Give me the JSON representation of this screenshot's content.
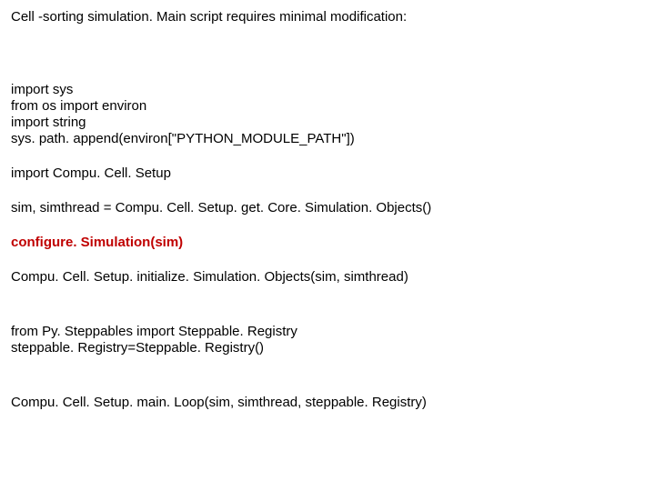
{
  "title": "Cell -sorting simulation. Main script requires minimal modification:",
  "code": {
    "l1": "import sys",
    "l2": "from os import environ",
    "l3": "import string",
    "l4": "sys. path. append(environ[\"PYTHON_MODULE_PATH\"])",
    "l5": "import Compu. Cell. Setup",
    "l6": "sim, simthread = Compu. Cell. Setup. get. Core. Simulation. Objects()",
    "l7": "configure. Simulation(sim)",
    "l8": "Compu. Cell. Setup. initialize. Simulation. Objects(sim, simthread)",
    "l9": "from Py. Steppables import Steppable. Registry",
    "l10": "steppable. Registry=Steppable. Registry()",
    "l11": "Compu. Cell. Setup. main. Loop(sim, simthread, steppable. Registry)"
  }
}
